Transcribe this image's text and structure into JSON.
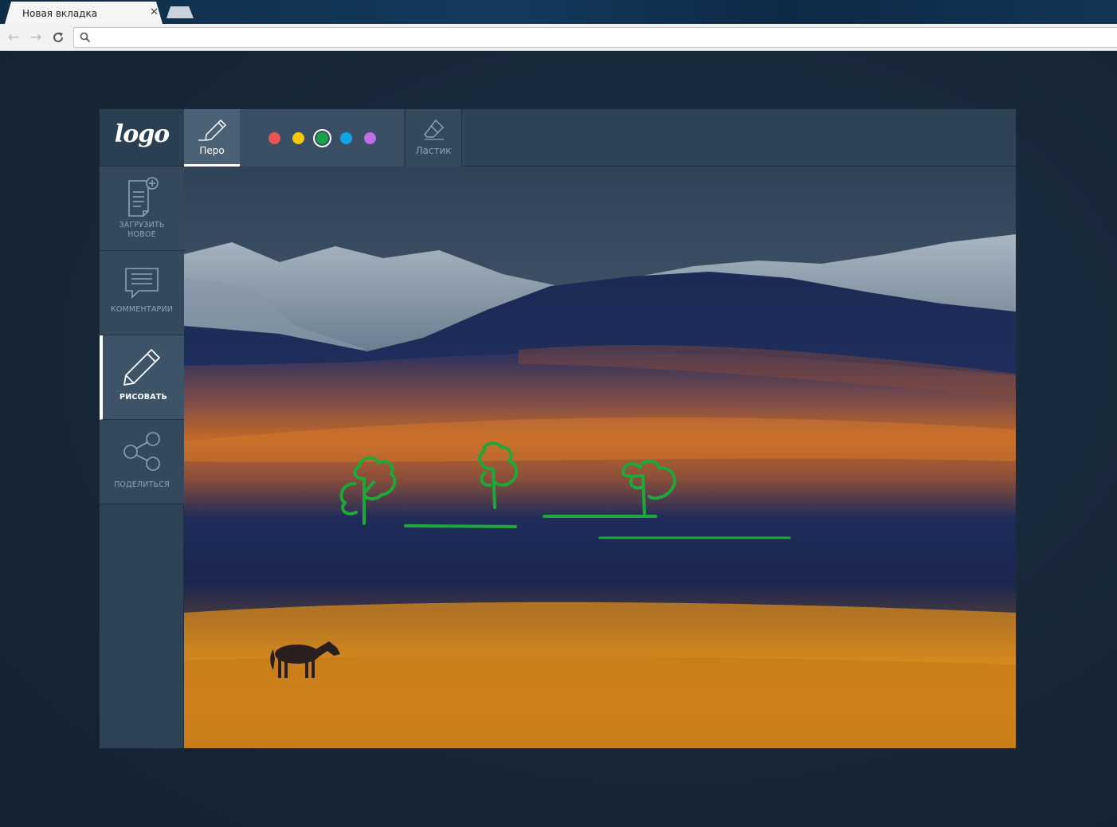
{
  "browser": {
    "tab_title": "Новая вкладка",
    "tab_close": "✕",
    "address_value": "",
    "address_placeholder": ""
  },
  "app": {
    "logo": "logo",
    "sidebar": {
      "items": [
        {
          "label_line1": "ЗАГРУЗИТЬ",
          "label_line2": "НОВОЕ",
          "icon": "document-add-icon",
          "active": false
        },
        {
          "label_line1": "КОММЕНТАРИИ",
          "label_line2": "",
          "icon": "comment-icon",
          "active": false
        },
        {
          "label_line1": "РИСОВАТЬ",
          "label_line2": "",
          "icon": "pencil-icon",
          "active": true
        },
        {
          "label_line1": "ПОДЕЛИТЬСЯ",
          "label_line2": "",
          "icon": "share-icon",
          "active": false
        }
      ]
    },
    "tools": {
      "pen_label": "Перо",
      "eraser_label": "Ластик",
      "selected_color_index": 2,
      "colors": [
        "#ef5350",
        "#f5c800",
        "#16a34a",
        "#0ea5e9",
        "#c06ee8"
      ]
    },
    "drawing_color": "#1fa83a"
  }
}
